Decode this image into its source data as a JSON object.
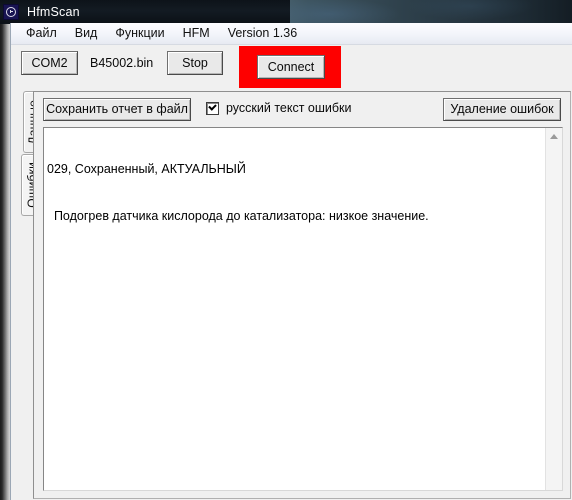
{
  "window": {
    "title": "HfmScan",
    "icon": "clock-icon"
  },
  "menubar": {
    "items": [
      {
        "label": "Файл"
      },
      {
        "label": "Вид"
      },
      {
        "label": "Функции"
      },
      {
        "label": "HFM"
      },
      {
        "label": "Version 1.36"
      }
    ]
  },
  "toolbar": {
    "com_port_button": "COM2",
    "file_name": "B45002.bin",
    "stop_button": "Stop",
    "connect_button": "Connect",
    "highlight_color": "#fe0000"
  },
  "panel": {
    "save_report_button": "Сохранить отчет в файл",
    "russian_text_checkbox": {
      "label": "русский текст ошибки",
      "checked": true
    },
    "delete_errors_button": "Удаление ошибок"
  },
  "tabs": [
    {
      "label": "Данные",
      "selected": false
    },
    {
      "label": "Ошибки",
      "selected": true
    }
  ],
  "report": {
    "lines": [
      "029, Сохраненный, АКТУАЛЬНЫЙ",
      "  Подогрев датчика кислорода до катализатора: низкое значение."
    ]
  },
  "scrollbar": {
    "up_arrow": "scroll-up-icon"
  }
}
